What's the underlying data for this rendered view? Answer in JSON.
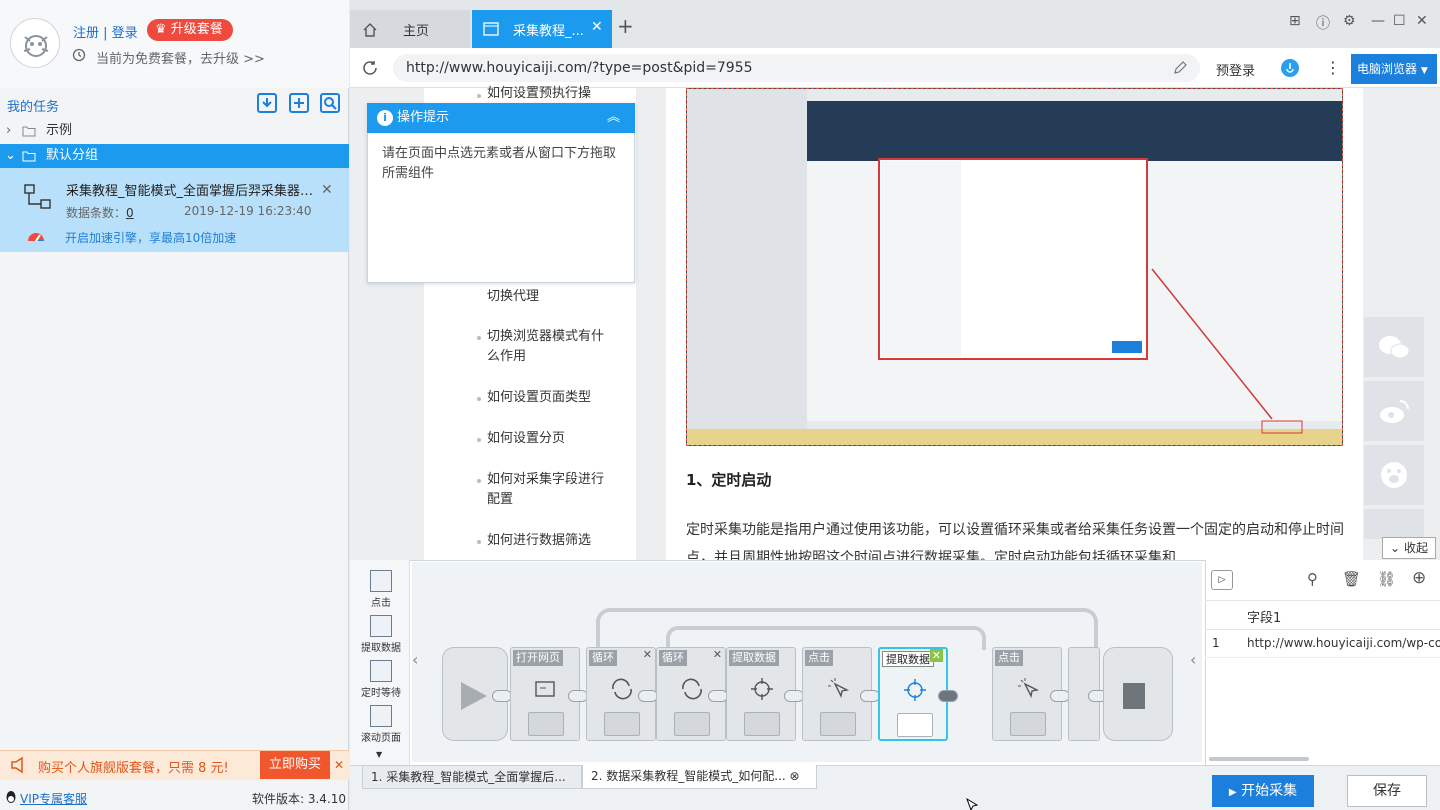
{
  "left": {
    "login_links": "注册 | 登录",
    "upgrade_label": "升级套餐",
    "free_tip": "当前为免费套餐，去升级 >>",
    "my_tasks": "我的任务",
    "tree": [
      {
        "label": "示例"
      },
      {
        "label": "默认分组"
      }
    ],
    "task": {
      "title": "采集教程_智能模式_全面掌握后羿采集器的...",
      "count_label": "数据条数：",
      "count": "0",
      "date": "2019-12-19 16:23:40",
      "speed_tip": "开启加速引擎，享最高10倍加速"
    },
    "promo": {
      "text": "购买个人旗舰版套餐，只需 8 元!",
      "button": "立即购买"
    },
    "vip": "VIP专属客服",
    "version": "软件版本: 3.4.10"
  },
  "browser": {
    "tabs": [
      {
        "label": "主页"
      },
      {
        "label": "采集教程_..."
      }
    ],
    "url": "http://www.houyicaiji.com/?type=post&pid=7955",
    "prelogin": "预登录",
    "browser_mode": "电脑浏览器"
  },
  "tip": {
    "title": "操作提示",
    "body": "请在页面中点选元素或者从窗口下方拖取所需组件"
  },
  "toc": [
    "如何设置预执行操",
    "切换代理",
    "切换浏览器模式有什么作用",
    "如何设置页面类型",
    "如何设置分页",
    "如何对采集字段进行配置",
    "如何进行数据筛选"
  ],
  "article": {
    "section_title": "1、定时启动",
    "paragraph": "定时采集功能是指用户通过使用该功能，可以设置循环采集或者给采集任务设置一个固定的启动和停止时间点，并且周期性地按照这个时间点进行数据采集。定时启动功能包括循环采集和",
    "collapse": "收起"
  },
  "palette": [
    {
      "label": "点击"
    },
    {
      "label": "提取数据"
    },
    {
      "label": "定时等待"
    },
    {
      "label": "滚动页面"
    }
  ],
  "flow_nodes": [
    {
      "label": "打开网页"
    },
    {
      "label": "循环"
    },
    {
      "label": "循环"
    },
    {
      "label": "提取数据"
    },
    {
      "label": "点击"
    },
    {
      "label": "提取数据"
    },
    {
      "label": "点击"
    }
  ],
  "fields": {
    "header": "字段1",
    "rows": [
      {
        "index": "1",
        "value": "http://www.houyicaiji.com/wp-conter"
      }
    ]
  },
  "bottom": {
    "tabs": [
      {
        "label": "1. 采集教程_智能模式_全面掌握后..."
      },
      {
        "label": "2. 数据采集教程_智能模式_如何配..."
      }
    ],
    "start": "开始采集",
    "save": "保存"
  },
  "colors": {
    "accent": "#1c9bee",
    "primary_button": "#1c7fdc",
    "promo": "#f0572c"
  }
}
